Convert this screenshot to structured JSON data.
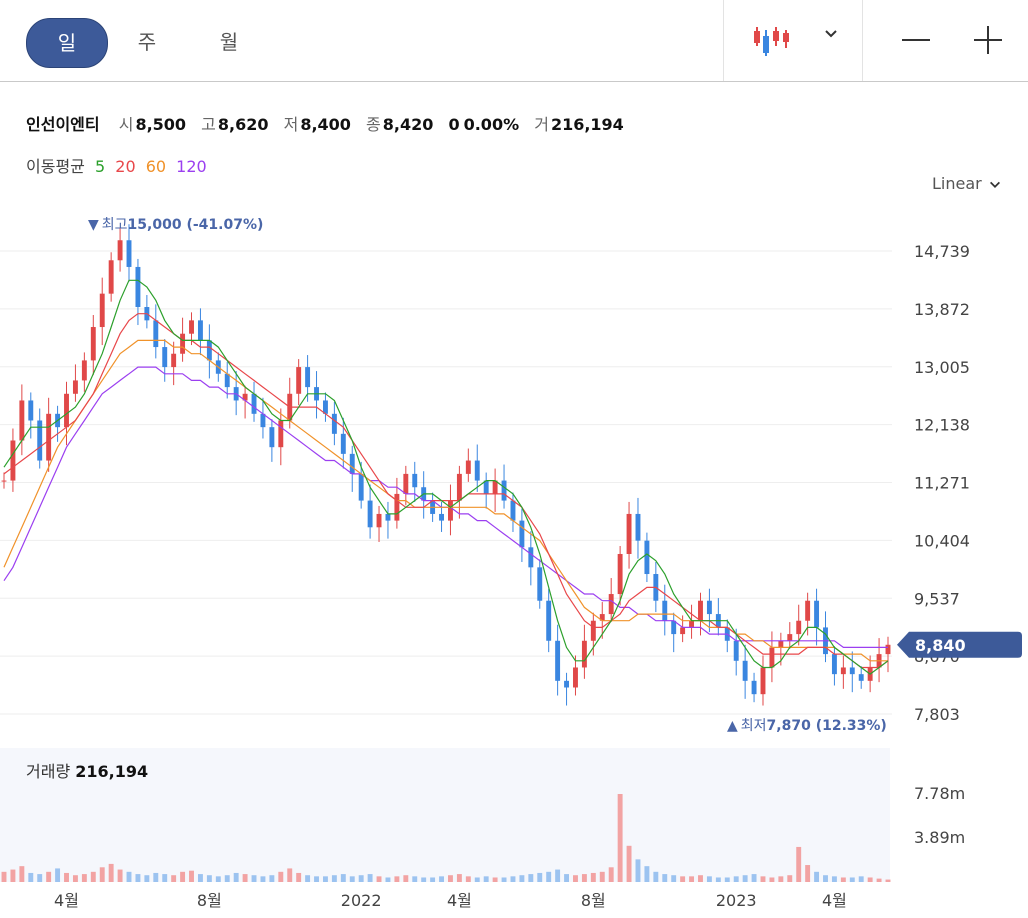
{
  "periods": {
    "day": "일",
    "week": "주",
    "month": "월"
  },
  "stock": {
    "name": "인선이엔티",
    "open_label": "시",
    "open": "8,500",
    "high_label": "고",
    "high": "8,620",
    "low_label": "저",
    "low": "8,400",
    "close_label": "종",
    "close": "8,420",
    "change": "0",
    "change_pct": "0.00%",
    "volume_label": "거",
    "volume": "216,194"
  },
  "ma_legend": {
    "label": "이동평균",
    "ma5": "5",
    "ma20": "20",
    "ma60": "60",
    "ma120": "120",
    "colors": {
      "ma5": "#2ca02c",
      "ma20": "#e8474a",
      "ma60": "#f0922a",
      "ma120": "#9b3ff0"
    }
  },
  "scale_selector": {
    "value": "Linear"
  },
  "annotations": {
    "high_marker": "▼",
    "high_text": "최고",
    "high_value": "15,000 (-41.07%)",
    "low_marker": "▲",
    "low_text": "최저",
    "low_value": "7,870 (12.33%)"
  },
  "current_price_tag": "8,840",
  "volume_panel": {
    "label": "거래량",
    "value": "216,194"
  },
  "colors": {
    "up": "#e04848",
    "down": "#3a86e0",
    "accent": "#3d5a99"
  },
  "icons": {
    "chart_type": "candlestick-icon",
    "dropdown": "chevron-down-icon",
    "zoom_out": "minus-icon",
    "zoom_in": "plus-icon"
  },
  "chart_data": {
    "type": "candlestick",
    "price_axis": {
      "ticks": [
        14739,
        13872,
        13005,
        12138,
        11271,
        10404,
        9537,
        8670,
        7803
      ],
      "tick_labels": [
        "14,739",
        "13,872",
        "13,005",
        "12,138",
        "11,271",
        "10,404",
        "9,537",
        "8,670",
        "7,803"
      ],
      "scale": "linear"
    },
    "volume_axis": {
      "ticks": [
        7780000,
        3890000
      ],
      "tick_labels": [
        "7.78m",
        "3.89m"
      ]
    },
    "x_axis": {
      "tick_labels": [
        "4월",
        "8월",
        "2022",
        "4월",
        "8월",
        "2023",
        "4월"
      ]
    },
    "series_close": [
      11300,
      11900,
      12500,
      12200,
      11600,
      12300,
      12100,
      12600,
      12800,
      13100,
      13600,
      14100,
      14600,
      14900,
      14500,
      13900,
      13700,
      13300,
      13000,
      13200,
      13500,
      13700,
      13400,
      13100,
      12900,
      12700,
      12500,
      12600,
      12300,
      12100,
      11800,
      12200,
      12600,
      13000,
      12700,
      12500,
      12300,
      12000,
      11700,
      11400,
      11000,
      10600,
      10800,
      10700,
      11100,
      11400,
      11200,
      11000,
      10800,
      10700,
      11000,
      11400,
      11600,
      11300,
      11100,
      11300,
      11000,
      10700,
      10300,
      10000,
      9500,
      8900,
      8300,
      8200,
      8500,
      8900,
      9200,
      9300,
      9600,
      10200,
      10800,
      10400,
      9900,
      9500,
      9200,
      9000,
      9100,
      9200,
      9500,
      9300,
      9100,
      8900,
      8600,
      8300,
      8100,
      8500,
      8800,
      8900,
      9000,
      9200,
      9500,
      9100,
      8700,
      8400,
      8500,
      8400,
      8300,
      8500,
      8700,
      8840
    ],
    "ma5": [
      11500,
      11700,
      11900,
      12100,
      12100,
      12100,
      12200,
      12300,
      12400,
      12600,
      12900,
      13200,
      13600,
      14000,
      14300,
      14300,
      14200,
      14000,
      13700,
      13500,
      13400,
      13400,
      13400,
      13400,
      13300,
      13100,
      12900,
      12700,
      12600,
      12500,
      12300,
      12200,
      12200,
      12400,
      12600,
      12600,
      12600,
      12500,
      12200,
      11900,
      11500,
      11200,
      11000,
      10800,
      10800,
      10900,
      11000,
      11100,
      11100,
      11000,
      10900,
      11000,
      11100,
      11200,
      11300,
      11300,
      11200,
      11100,
      10900,
      10600,
      10200,
      9700,
      9200,
      8800,
      8600,
      8600,
      8800,
      9000,
      9200,
      9500,
      9900,
      10100,
      10200,
      10100,
      9900,
      9600,
      9400,
      9200,
      9200,
      9200,
      9200,
      9200,
      9000,
      8800,
      8600,
      8500,
      8500,
      8600,
      8800,
      8900,
      9100,
      9100,
      9000,
      8800,
      8700,
      8600,
      8500,
      8400,
      8500,
      8600
    ],
    "ma20": [
      11400,
      11500,
      11600,
      11700,
      11800,
      11900,
      12000,
      12100,
      12200,
      12400,
      12600,
      12900,
      13200,
      13500,
      13700,
      13800,
      13800,
      13700,
      13600,
      13500,
      13400,
      13400,
      13300,
      13300,
      13200,
      13100,
      13000,
      12900,
      12800,
      12700,
      12600,
      12500,
      12400,
      12400,
      12400,
      12400,
      12300,
      12200,
      12100,
      11900,
      11700,
      11500,
      11300,
      11100,
      11000,
      10900,
      10900,
      10900,
      11000,
      11000,
      11000,
      11000,
      11100,
      11100,
      11100,
      11100,
      11100,
      11000,
      10900,
      10700,
      10500,
      10200,
      9900,
      9600,
      9400,
      9200,
      9100,
      9100,
      9200,
      9300,
      9500,
      9600,
      9700,
      9700,
      9600,
      9500,
      9400,
      9300,
      9200,
      9200,
      9100,
      9100,
      9000,
      8900,
      8800,
      8700,
      8700,
      8700,
      8700,
      8700,
      8800,
      8800,
      8800,
      8700,
      8700,
      8600,
      8500,
      8500,
      8500,
      8600
    ],
    "ma60": [
      10000,
      10300,
      10600,
      10900,
      11200,
      11500,
      11800,
      12000,
      12200,
      12400,
      12600,
      12800,
      13000,
      13200,
      13300,
      13400,
      13400,
      13400,
      13400,
      13300,
      13300,
      13200,
      13200,
      13100,
      13000,
      12900,
      12800,
      12700,
      12600,
      12500,
      12400,
      12300,
      12200,
      12100,
      12000,
      11900,
      11800,
      11700,
      11600,
      11500,
      11400,
      11300,
      11200,
      11100,
      11000,
      11000,
      10900,
      10900,
      10900,
      10900,
      10900,
      10900,
      10900,
      10900,
      10900,
      10800,
      10800,
      10700,
      10600,
      10500,
      10400,
      10200,
      10000,
      9800,
      9600,
      9400,
      9300,
      9200,
      9200,
      9200,
      9200,
      9300,
      9300,
      9300,
      9300,
      9300,
      9200,
      9200,
      9200,
      9100,
      9100,
      9100,
      9000,
      9000,
      8900,
      8900,
      8800,
      8800,
      8800,
      8800,
      8800,
      8800,
      8800,
      8800,
      8700,
      8700,
      8700,
      8600,
      8600,
      8600
    ],
    "ma120": [
      9800,
      10000,
      10300,
      10600,
      10900,
      11200,
      11500,
      11800,
      12000,
      12200,
      12400,
      12600,
      12700,
      12800,
      12900,
      13000,
      13000,
      13000,
      12900,
      12900,
      12900,
      12800,
      12800,
      12700,
      12700,
      12600,
      12600,
      12500,
      12400,
      12300,
      12200,
      12100,
      12000,
      11900,
      11800,
      11700,
      11600,
      11600,
      11500,
      11400,
      11400,
      11300,
      11300,
      11200,
      11200,
      11100,
      11100,
      11000,
      11000,
      10900,
      10900,
      10800,
      10800,
      10700,
      10700,
      10600,
      10500,
      10400,
      10300,
      10200,
      10100,
      10000,
      9900,
      9800,
      9700,
      9600,
      9600,
      9500,
      9500,
      9400,
      9400,
      9300,
      9300,
      9200,
      9200,
      9200,
      9100,
      9100,
      9100,
      9000,
      9000,
      9000,
      8900,
      8900,
      8900,
      8900,
      8900,
      8900,
      8900,
      8900,
      8900,
      8900,
      8900,
      8900,
      8800,
      8800,
      8800,
      8800,
      8800,
      8800
    ],
    "volume": [
      900000,
      1100000,
      1400000,
      800000,
      700000,
      900000,
      1200000,
      800000,
      600000,
      700000,
      900000,
      1300000,
      1600000,
      1100000,
      900000,
      700000,
      600000,
      800000,
      700000,
      600000,
      900000,
      1000000,
      700000,
      600000,
      500000,
      600000,
      800000,
      700000,
      600000,
      500000,
      600000,
      900000,
      1200000,
      800000,
      600000,
      500000,
      500000,
      600000,
      700000,
      500000,
      600000,
      700000,
      500000,
      400000,
      500000,
      600000,
      500000,
      400000,
      400000,
      500000,
      600000,
      700000,
      500000,
      400000,
      500000,
      400000,
      400000,
      500000,
      600000,
      700000,
      800000,
      900000,
      1100000,
      700000,
      600000,
      700000,
      800000,
      900000,
      1300000,
      7780000,
      3200000,
      2000000,
      1400000,
      900000,
      700000,
      600000,
      500000,
      500000,
      600000,
      500000,
      400000,
      400000,
      500000,
      600000,
      700000,
      500000,
      400000,
      500000,
      600000,
      3100000,
      1500000,
      900000,
      600000,
      500000,
      400000,
      400000,
      500000,
      400000,
      300000,
      216194
    ]
  }
}
